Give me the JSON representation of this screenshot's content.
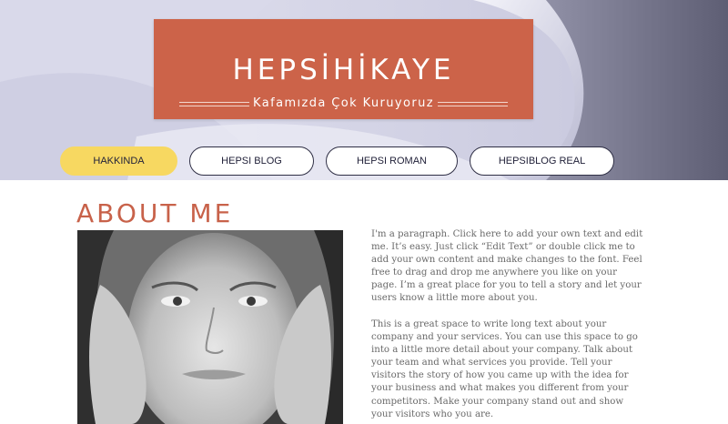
{
  "header": {
    "title": "HEPSİHİKAYE",
    "subtitle": "Kafamızda Çok Kuruyoruz"
  },
  "nav": {
    "items": [
      {
        "label": "HAKKINDA",
        "active": true
      },
      {
        "label": "HEPSI BLOG",
        "active": false
      },
      {
        "label": "HEPSI ROMAN",
        "active": false
      },
      {
        "label": "HEPSIBLOG REAL",
        "active": false
      }
    ]
  },
  "about": {
    "heading": "ABOUT ME",
    "paragraph_1": "I'm a paragraph. Click here to add your own text and edit me. It’s easy. Just click “Edit Text” or double click me to add your own content and make changes to the font. Feel free to drag and drop me anywhere you like on your page. I’m a great place for you to tell a story and let your users know a little more about you.",
    "paragraph_2": "This is a great space to write long text about your company and your services. You can use this space to go into a little more detail about your company. Talk about your team and what services you provide. Tell your visitors the story of how you came up with the idea for your business and what makes you different from your competitors. Make your company stand out and show your visitors who you are."
  },
  "colors": {
    "accent": "#cc6349",
    "nav_active": "#f7d861",
    "nav_border": "#2f2f45",
    "body_text": "#6a6a6a"
  }
}
